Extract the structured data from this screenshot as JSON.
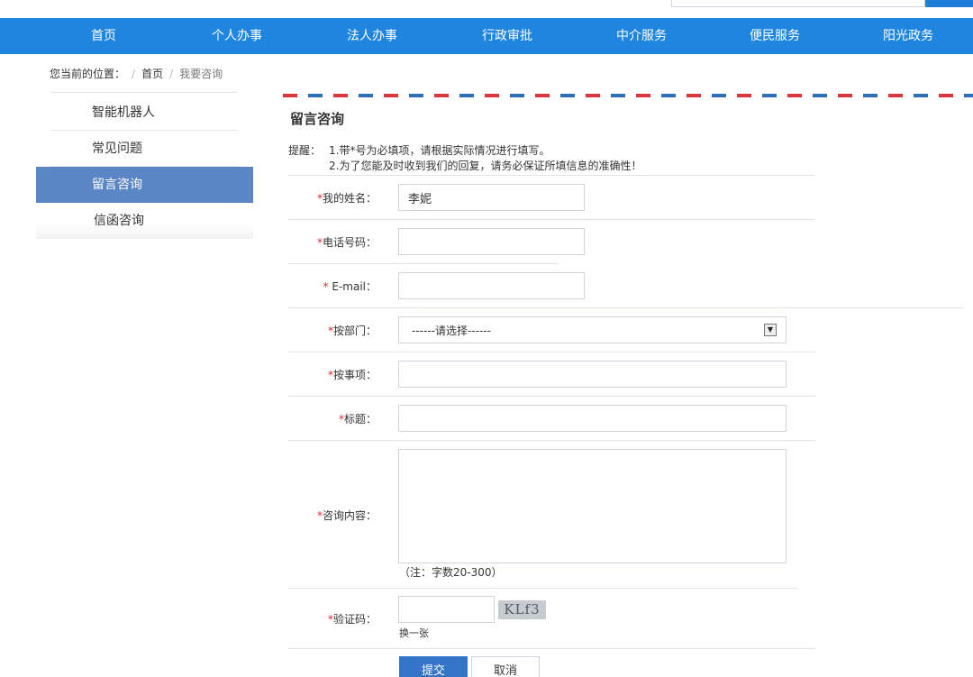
{
  "nav": {
    "items": [
      "首页",
      "个人办事",
      "法人办事",
      "行政审批",
      "中介服务",
      "便民服务",
      "阳光政务"
    ]
  },
  "breadcrumb": {
    "prefix": "您当前的位置：",
    "home": "首页",
    "current": "我要咨询"
  },
  "sidebar": {
    "items": [
      {
        "label": "智能机器人"
      },
      {
        "label": "常见问题"
      },
      {
        "label": "留言咨询",
        "active": true
      },
      {
        "label": "信函咨询"
      }
    ]
  },
  "section": {
    "title": "留言咨询"
  },
  "notice": {
    "label": "提醒：",
    "line1": "1.带*号为必填项，请根据实际情况进行填写。",
    "line2": "2.为了您能及时收到我们的回复，请务必保证所填信息的准确性！"
  },
  "form": {
    "required_mark": "*",
    "name_label": "我的姓名：",
    "name_value": "李妮",
    "phone_label": "电话号码：",
    "phone_value": "",
    "email_label": "E-mail：",
    "email_value": "",
    "dept_label": "按部门：",
    "dept_selected": "------请选择------",
    "matter_label": "按事项：",
    "matter_value": "",
    "title_label": "标题：",
    "title_value": "",
    "content_label": "咨询内容：",
    "content_value": "",
    "content_note": "（注：字数20-300）",
    "captcha_label": "验证码：",
    "captcha_value": "",
    "captcha_text": "KLf3",
    "refresh_label": "换一张",
    "submit_label": "提交",
    "cancel_label": "取消"
  },
  "colors": {
    "nav_bg": "#1f86e0",
    "sidebar_active": "#5b86c5",
    "required": "#e0262b",
    "submit_bg": "#3475c7"
  }
}
